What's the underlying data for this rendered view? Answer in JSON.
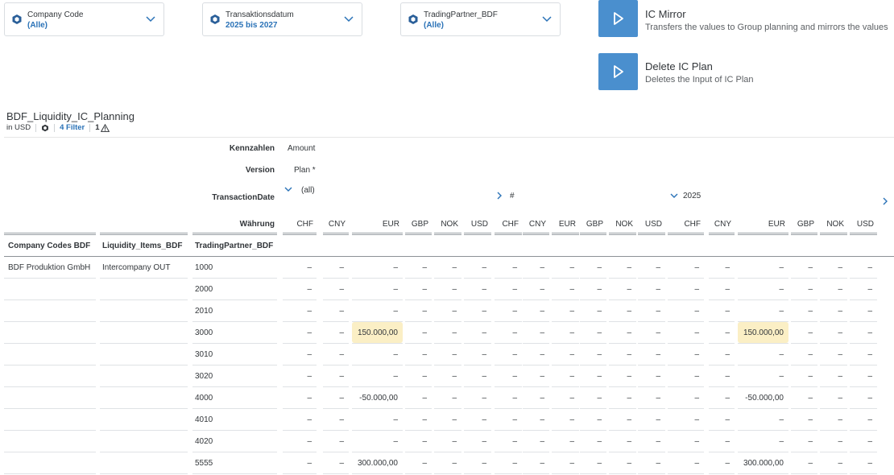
{
  "filters": [
    {
      "label": "Company Code",
      "value": "(Alle)"
    },
    {
      "label": "Transaktionsdatum",
      "value": "2025 bis 2027"
    },
    {
      "label": "TradingPartner_BDF",
      "value": "(Alle)"
    }
  ],
  "actions": [
    {
      "title": "IC Mirror",
      "description": "Transfers the values to Group planning and mirrors the values"
    },
    {
      "title": "Delete IC Plan",
      "description": "Deletes the Input of IC Plan"
    }
  ],
  "report": {
    "title": "BDF_Liquidity_IC_Planning",
    "currency": "in USD",
    "filter_link": "4 Filter",
    "warnings": "1"
  },
  "header_rows": {
    "kennzahlen": {
      "label": "Kennzahlen",
      "value": "Amount"
    },
    "version": {
      "label": "Version",
      "value": "Plan *"
    },
    "transaction": {
      "label": "TransactionDate",
      "all": "(all)",
      "hash": "#",
      "year": "2025"
    },
    "waehrung": {
      "label": "Währung"
    }
  },
  "row_headers": {
    "company": "Company Codes BDF",
    "liquidity": "Liquidity_Items_BDF",
    "partner": "TradingPartner_BDF"
  },
  "currencies": [
    "CHF",
    "CNY",
    "EUR",
    "GBP",
    "NOK",
    "USD",
    "CHF",
    "CNY",
    "EUR",
    "GBP",
    "NOK",
    "USD",
    "CHF",
    "CNY",
    "EUR",
    "GBP",
    "NOK",
    "USD"
  ],
  "rows": [
    {
      "company": "BDF Produktion GmbH",
      "liquidity": "Intercompany OUT",
      "partner": "1000",
      "values": [
        "–",
        "–",
        "–",
        "–",
        "–",
        "–",
        "–",
        "–",
        "–",
        "–",
        "–",
        "–",
        "–",
        "–",
        "–",
        "–",
        "–",
        "–"
      ]
    },
    {
      "company": "",
      "liquidity": "",
      "partner": "2000",
      "values": [
        "–",
        "–",
        "–",
        "–",
        "–",
        "–",
        "–",
        "–",
        "–",
        "–",
        "–",
        "–",
        "–",
        "–",
        "–",
        "–",
        "–",
        "–"
      ]
    },
    {
      "company": "",
      "liquidity": "",
      "partner": "2010",
      "values": [
        "–",
        "–",
        "–",
        "–",
        "–",
        "–",
        "–",
        "–",
        "–",
        "–",
        "–",
        "–",
        "–",
        "–",
        "–",
        "–",
        "–",
        "–"
      ]
    },
    {
      "company": "",
      "liquidity": "",
      "partner": "3000",
      "values": [
        "–",
        "–",
        "150.000,00",
        "–",
        "–",
        "–",
        "–",
        "–",
        "–",
        "–",
        "–",
        "–",
        "–",
        "–",
        "150.000,00",
        "–",
        "–",
        "–"
      ],
      "highlight": [
        2,
        14
      ]
    },
    {
      "company": "",
      "liquidity": "",
      "partner": "3010",
      "values": [
        "–",
        "–",
        "–",
        "–",
        "–",
        "–",
        "–",
        "–",
        "–",
        "–",
        "–",
        "–",
        "–",
        "–",
        "–",
        "–",
        "–",
        "–"
      ]
    },
    {
      "company": "",
      "liquidity": "",
      "partner": "3020",
      "values": [
        "–",
        "–",
        "–",
        "–",
        "–",
        "–",
        "–",
        "–",
        "–",
        "–",
        "–",
        "–",
        "–",
        "–",
        "–",
        "–",
        "–",
        "–"
      ]
    },
    {
      "company": "",
      "liquidity": "",
      "partner": "4000",
      "values": [
        "–",
        "–",
        "-50.000,00",
        "–",
        "–",
        "–",
        "–",
        "–",
        "–",
        "–",
        "–",
        "–",
        "–",
        "–",
        "-50.000,00",
        "–",
        "–",
        "–"
      ]
    },
    {
      "company": "",
      "liquidity": "",
      "partner": "4010",
      "values": [
        "–",
        "–",
        "–",
        "–",
        "–",
        "–",
        "–",
        "–",
        "–",
        "–",
        "–",
        "–",
        "–",
        "–",
        "–",
        "–",
        "–",
        "–"
      ]
    },
    {
      "company": "",
      "liquidity": "",
      "partner": "4020",
      "values": [
        "–",
        "–",
        "–",
        "–",
        "–",
        "–",
        "–",
        "–",
        "–",
        "–",
        "–",
        "–",
        "–",
        "–",
        "–",
        "–",
        "–",
        "–"
      ]
    },
    {
      "company": "",
      "liquidity": "",
      "partner": "5555",
      "values": [
        "–",
        "–",
        "300.000,00",
        "–",
        "–",
        "–",
        "–",
        "–",
        "–",
        "–",
        "–",
        "–",
        "–",
        "–",
        "300.000,00",
        "–",
        "–",
        "–"
      ]
    }
  ],
  "colors": {
    "accent": "#4a8fce",
    "link": "#2a72b7",
    "highlight": "#fbefc5"
  }
}
